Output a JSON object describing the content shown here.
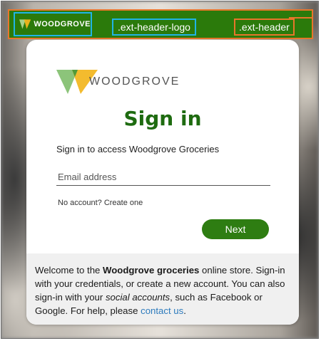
{
  "header": {
    "logo_text": "WOODGROVE",
    "logo_annotation": ".ext-header-logo",
    "header_annotation": ".ext-header",
    "bg_color": "#2b7a0b",
    "logo_outline_color": "#20b4e6",
    "header_outline_color": "#e8762a"
  },
  "card": {
    "logo_text": "WOODGROVE",
    "title": "Sign in",
    "subtitle": "Sign in to access Woodgrove Groceries",
    "email": {
      "placeholder": "Email address",
      "value": ""
    },
    "no_account": "No account? Create one",
    "next_label": "Next",
    "accent_color": "#2e7d12"
  },
  "footer": {
    "text_1": "Welcome to the ",
    "bold_1": "Woodgrove groceries",
    "text_2": " online store. Sign-in with your credentials, or create a new account. You can also sign-in with your ",
    "italic_1": "social accounts",
    "text_3": ", such as Facebook or Google. For help, please ",
    "link": "contact us",
    "text_4": "."
  }
}
